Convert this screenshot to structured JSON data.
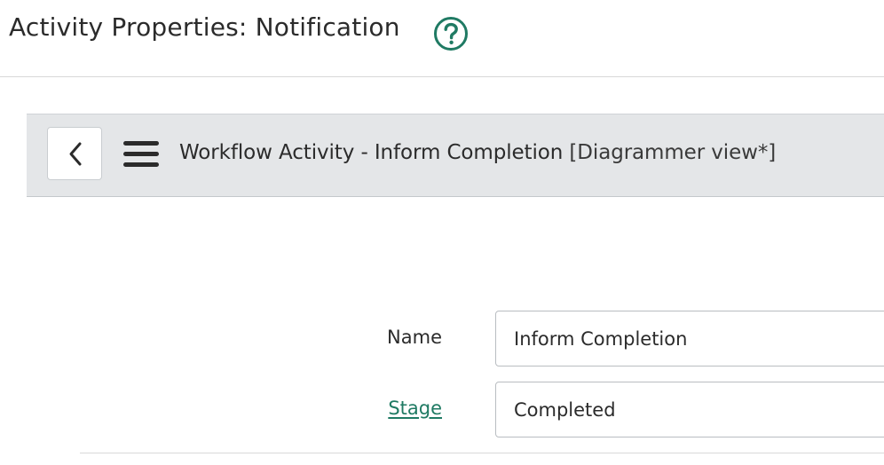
{
  "modal": {
    "title": "Activity Properties: Notification",
    "help_icon": "question-circle-icon"
  },
  "form_header": {
    "back_icon": "chevron-left-icon",
    "menu_icon": "hamburger-menu-icon",
    "title": "Workflow Activity - Inform Completion",
    "view_label": "[Diagrammer view*]"
  },
  "fields": {
    "name": {
      "label": "Name",
      "value": "Inform Completion"
    },
    "stage": {
      "label": "Stage",
      "value": "Completed"
    }
  },
  "colors": {
    "accent": "#1f7a63",
    "header_bg": "#e4e6e8",
    "text": "#2b2b2b"
  }
}
